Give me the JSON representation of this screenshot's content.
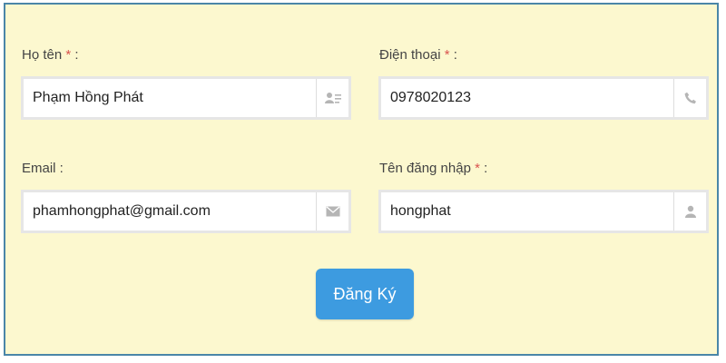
{
  "form": {
    "fullname": {
      "label": "Họ tên",
      "required_mark": "*",
      "colon": ":",
      "value": "Phạm Hồng Phát",
      "icon": "contact-card-icon"
    },
    "phone": {
      "label": "Điện thoại",
      "required_mark": "*",
      "colon": ":",
      "value": "0978020123",
      "icon": "phone-icon"
    },
    "email": {
      "label": "Email :",
      "value": "phamhongphat@gmail.com",
      "icon": "envelope-icon"
    },
    "username": {
      "label": "Tên đăng nhập",
      "required_mark": "*",
      "colon": ":",
      "value": "hongphat",
      "icon": "user-icon"
    },
    "submit_label": "Đăng Ký"
  },
  "colors": {
    "background": "#fcf8cf",
    "border": "#4a86a8",
    "required": "#d9534f",
    "button": "#3d9be0"
  }
}
